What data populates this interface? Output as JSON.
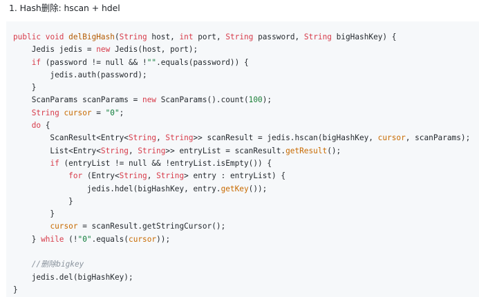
{
  "heading": "1. Hash删除: hscan + hdel",
  "code": {
    "language": "java",
    "lines": [
      [
        [
          "k",
          "public"
        ],
        [
          "p",
          " "
        ],
        [
          "k",
          "void"
        ],
        [
          "p",
          " "
        ],
        [
          "f",
          "delBigHash"
        ],
        [
          "p",
          "("
        ],
        [
          "t",
          "String"
        ],
        [
          "p",
          " host, "
        ],
        [
          "t",
          "int"
        ],
        [
          "p",
          " port, "
        ],
        [
          "t",
          "String"
        ],
        [
          "p",
          " password, "
        ],
        [
          "t",
          "String"
        ],
        [
          "p",
          " bigHashKey) {"
        ]
      ],
      [
        [
          "p",
          "    Jedis jedis = "
        ],
        [
          "k",
          "new"
        ],
        [
          "p",
          " Jedis(host, port);"
        ]
      ],
      [
        [
          "p",
          "    "
        ],
        [
          "k",
          "if"
        ],
        [
          "p",
          " (password != null && !"
        ],
        [
          "s",
          "\"\""
        ],
        [
          "p",
          ".equals(password)) {"
        ]
      ],
      [
        [
          "p",
          "        jedis.auth(password);"
        ]
      ],
      [
        [
          "p",
          "    }"
        ]
      ],
      [
        [
          "p",
          "    ScanParams scanParams = "
        ],
        [
          "k",
          "new"
        ],
        [
          "p",
          " ScanParams().count("
        ],
        [
          "n",
          "100"
        ],
        [
          "p",
          ");"
        ]
      ],
      [
        [
          "p",
          "    "
        ],
        [
          "t",
          "String"
        ],
        [
          "p",
          " "
        ],
        [
          "v",
          "cursor"
        ],
        [
          "p",
          " = "
        ],
        [
          "s",
          "\"0\""
        ],
        [
          "p",
          ";"
        ]
      ],
      [
        [
          "p",
          "    "
        ],
        [
          "k",
          "do"
        ],
        [
          "p",
          " {"
        ]
      ],
      [
        [
          "p",
          "        ScanResult<Entry<"
        ],
        [
          "t",
          "String"
        ],
        [
          "p",
          ", "
        ],
        [
          "t",
          "String"
        ],
        [
          "p",
          ">> scanResult = jedis.hscan(bigHashKey, "
        ],
        [
          "v",
          "cursor"
        ],
        [
          "p",
          ", scanParams);"
        ]
      ],
      [
        [
          "p",
          "        List<Entry<"
        ],
        [
          "t",
          "String"
        ],
        [
          "p",
          ", "
        ],
        [
          "t",
          "String"
        ],
        [
          "p",
          ">> entryList = scanResult."
        ],
        [
          "v",
          "getResult"
        ],
        [
          "p",
          "();"
        ]
      ],
      [
        [
          "p",
          "        "
        ],
        [
          "k",
          "if"
        ],
        [
          "p",
          " (entryList != null && !entryList.isEmpty()) {"
        ]
      ],
      [
        [
          "p",
          "            "
        ],
        [
          "k",
          "for"
        ],
        [
          "p",
          " (Entry<"
        ],
        [
          "t",
          "String"
        ],
        [
          "p",
          ", "
        ],
        [
          "t",
          "String"
        ],
        [
          "p",
          "> entry : entryList) {"
        ]
      ],
      [
        [
          "p",
          "                jedis.hdel(bigHashKey, entry."
        ],
        [
          "v",
          "getKey"
        ],
        [
          "p",
          "());"
        ]
      ],
      [
        [
          "p",
          "            }"
        ]
      ],
      [
        [
          "p",
          "        }"
        ]
      ],
      [
        [
          "p",
          "        "
        ],
        [
          "v",
          "cursor"
        ],
        [
          "p",
          " = scanResult.getStringCursor();"
        ]
      ],
      [
        [
          "p",
          "    } "
        ],
        [
          "k",
          "while"
        ],
        [
          "p",
          " (!"
        ],
        [
          "s",
          "\"0\""
        ],
        [
          "p",
          ".equals("
        ],
        [
          "v",
          "cursor"
        ],
        [
          "p",
          "));"
        ]
      ],
      [
        [
          "p",
          ""
        ]
      ],
      [
        [
          "p",
          "    "
        ],
        [
          "c",
          "//删除bigkey"
        ]
      ],
      [
        [
          "p",
          "    jedis.del(bigHashKey);"
        ]
      ],
      [
        [
          "p",
          "}"
        ]
      ]
    ]
  },
  "colors": {
    "code_background": "#f6f8fa",
    "keyword": "#d73a49",
    "function_name": "#b35a00",
    "string": "#0a7a36",
    "number": "#1a7f37",
    "comment": "#8b949e",
    "variable": "#c86a00"
  }
}
